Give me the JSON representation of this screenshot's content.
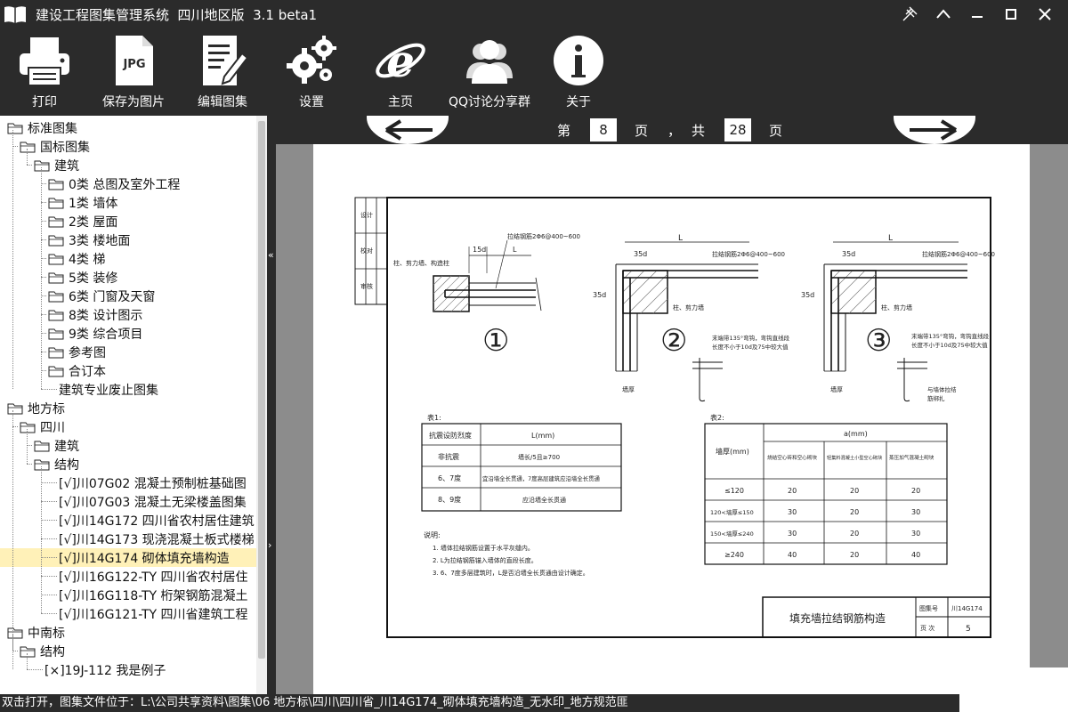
{
  "window": {
    "title": "建设工程图集管理系统  四川地区版  3.1 beta1"
  },
  "toolbar": {
    "items": [
      {
        "label": "打印",
        "icon": "printer-icon"
      },
      {
        "label": "保存为图片",
        "icon": "jpg-file-icon"
      },
      {
        "label": "编辑图集",
        "icon": "edit-document-icon"
      },
      {
        "label": "设置",
        "icon": "gears-icon"
      },
      {
        "label": "主页",
        "icon": "ie-browser-icon"
      },
      {
        "label": "QQ讨论分享群",
        "icon": "users-group-icon"
      },
      {
        "label": "关于",
        "icon": "info-icon"
      }
    ]
  },
  "tree": {
    "nodes": [
      {
        "label": "标准图集",
        "depth": 0,
        "folder": true
      },
      {
        "label": "国标图集",
        "depth": 1,
        "folder": true
      },
      {
        "label": "建筑",
        "depth": 2,
        "folder": true
      },
      {
        "label": "0类 总图及室外工程",
        "depth": 3,
        "folder": true
      },
      {
        "label": "1类 墙体",
        "depth": 3,
        "folder": true
      },
      {
        "label": "2类 屋面",
        "depth": 3,
        "folder": true
      },
      {
        "label": "3类 楼地面",
        "depth": 3,
        "folder": true
      },
      {
        "label": "4类 梯",
        "depth": 3,
        "folder": true
      },
      {
        "label": "5类 装修",
        "depth": 3,
        "folder": true
      },
      {
        "label": "6类 门窗及天窗",
        "depth": 3,
        "folder": true
      },
      {
        "label": "8类 设计图示",
        "depth": 3,
        "folder": true
      },
      {
        "label": "9类 综合项目",
        "depth": 3,
        "folder": true
      },
      {
        "label": "参考图",
        "depth": 3,
        "folder": true
      },
      {
        "label": "合订本",
        "depth": 3,
        "folder": true
      },
      {
        "label": "建筑专业废止图集",
        "depth": 3,
        "folder": false
      },
      {
        "label": "地方标",
        "depth": 0,
        "folder": true
      },
      {
        "label": "四川",
        "depth": 1,
        "folder": true
      },
      {
        "label": "建筑",
        "depth": 2,
        "folder": true
      },
      {
        "label": "结构",
        "depth": 2,
        "folder": true
      },
      {
        "label": "[√]川07G02  混凝土预制桩基础图",
        "depth": 3,
        "folder": false
      },
      {
        "label": "[√]川07G03  混凝土无梁楼盖图集",
        "depth": 3,
        "folder": false
      },
      {
        "label": "[√]川14G172  四川省农村居住建筑",
        "depth": 3,
        "folder": false
      },
      {
        "label": "[√]川14G173  现浇混凝土板式楼梯",
        "depth": 3,
        "folder": false
      },
      {
        "label": "[√]川14G174  砌体填充墙构造",
        "depth": 3,
        "folder": false,
        "selected": true
      },
      {
        "label": "[√]川16G122-TY  四川省农村居住",
        "depth": 3,
        "folder": false
      },
      {
        "label": "[√]川16G118-TY  桁架钢筋混凝土",
        "depth": 3,
        "folder": false
      },
      {
        "label": "[√]川16G121-TY  四川省建筑工程",
        "depth": 3,
        "folder": false
      },
      {
        "label": "中南标",
        "depth": 0,
        "folder": true
      },
      {
        "label": "结构",
        "depth": 1,
        "folder": true
      },
      {
        "label": "[×]19J-112  我是例子",
        "depth": 2,
        "folder": false
      }
    ]
  },
  "pager": {
    "prefix": "第",
    "current": "8",
    "mid": "页",
    "sep": "，",
    "total_label": "共",
    "total": "28",
    "suffix": "页"
  },
  "drawing": {
    "title": "填充墙拉结钢筋构造",
    "atlas_label": "图集号",
    "atlas_no": "川14G174",
    "page_label": "页  次",
    "page_no": "5",
    "left_strip": [
      "设计",
      "校对",
      "审核"
    ],
    "detail_labels": {
      "rebar": "拉结钢筋2Φ6@400~600",
      "column": "柱、剪力墙、构造柱",
      "column2": "柱、剪力墙",
      "dim_15d": "15d",
      "dim_35d": "35d",
      "dim_L": "L",
      "dim_a": "a",
      "wall_thk": "墙厚",
      "hook_note1": "末端带135°弯钩，弯钩直线段",
      "hook_note2": "长度不小于10d及75中较大值",
      "tie_note1": "与墙体拉结",
      "tie_note2": "筋绑扎",
      "n1": "①",
      "n2": "②",
      "n3": "③"
    },
    "table1": {
      "caption": "表1:",
      "headers": [
        "抗震设防烈度",
        "L(mm)"
      ],
      "rows": [
        [
          "非抗震",
          "墙长/5且≥700"
        ],
        [
          "6、7度",
          "宜沿墙全长贯通，7度高层建筑应沿墙全长贯通"
        ],
        [
          "8、9度",
          "应沿墙全长贯通"
        ]
      ]
    },
    "table2": {
      "caption": "表2:",
      "header_main": "墙厚(mm)",
      "header_a": "a(mm)",
      "cols": [
        "烧结空心砖和空心砌块",
        "轻集料混凝土小型空心砌块",
        "蒸压加气混凝土砌块"
      ],
      "rows": [
        [
          "≤120",
          "20",
          "20",
          "20"
        ],
        [
          "120<墙厚≤150",
          "30",
          "20",
          "30"
        ],
        [
          "150<墙厚≤240",
          "30",
          "20",
          "30"
        ],
        [
          "≥240",
          "40",
          "20",
          "40"
        ]
      ]
    },
    "notes": {
      "title": "说明:",
      "items": [
        "1. 墙体拉结钢筋设置于水平灰缝内。",
        "2. L为拉结钢筋锚入墙体的直段长度。",
        "3. 6、7度多层建筑时，L是否沿墙全长贯通由设计确定。"
      ]
    }
  },
  "statusbar": {
    "text": "双击打开，图集文件位于：L:\\公司共享资料\\图集\\06 地方标\\四川\\四川省_川14G174_砌体填充墙构造_无水印_地方规范匪"
  },
  "colors": {
    "bg": "#2b2b2b",
    "selected": "#fff1b8",
    "canvas": "#8c8c8c"
  }
}
